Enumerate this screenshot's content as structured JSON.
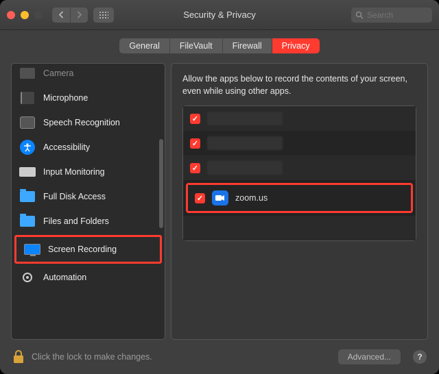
{
  "window": {
    "title": "Security & Privacy"
  },
  "search": {
    "placeholder": "Search"
  },
  "tabs": [
    {
      "label": "General",
      "active": false
    },
    {
      "label": "FileVault",
      "active": false
    },
    {
      "label": "Firewall",
      "active": false
    },
    {
      "label": "Privacy",
      "active": true
    }
  ],
  "sidebar": {
    "items": [
      {
        "label": "Camera",
        "icon": "camera-icon"
      },
      {
        "label": "Microphone",
        "icon": "microphone-icon"
      },
      {
        "label": "Speech Recognition",
        "icon": "speech-icon"
      },
      {
        "label": "Accessibility",
        "icon": "accessibility-icon"
      },
      {
        "label": "Input Monitoring",
        "icon": "keyboard-icon"
      },
      {
        "label": "Full Disk Access",
        "icon": "folder-icon"
      },
      {
        "label": "Files and Folders",
        "icon": "folder-icon"
      },
      {
        "label": "Screen Recording",
        "icon": "monitor-icon",
        "selected": true,
        "highlighted": true
      },
      {
        "label": "Automation",
        "icon": "gear-icon"
      }
    ]
  },
  "main": {
    "description": "Allow the apps below to record the contents of your screen, even while using other apps.",
    "apps": [
      {
        "checked": true,
        "name": "",
        "redacted": true
      },
      {
        "checked": true,
        "name": "",
        "redacted": true
      },
      {
        "checked": true,
        "name": "",
        "redacted": true
      },
      {
        "checked": true,
        "name": "zoom.us",
        "icon": "zoom-icon",
        "highlighted": true
      }
    ]
  },
  "footer": {
    "lock_text": "Click the lock to make changes.",
    "advanced_label": "Advanced...",
    "help_label": "?"
  }
}
